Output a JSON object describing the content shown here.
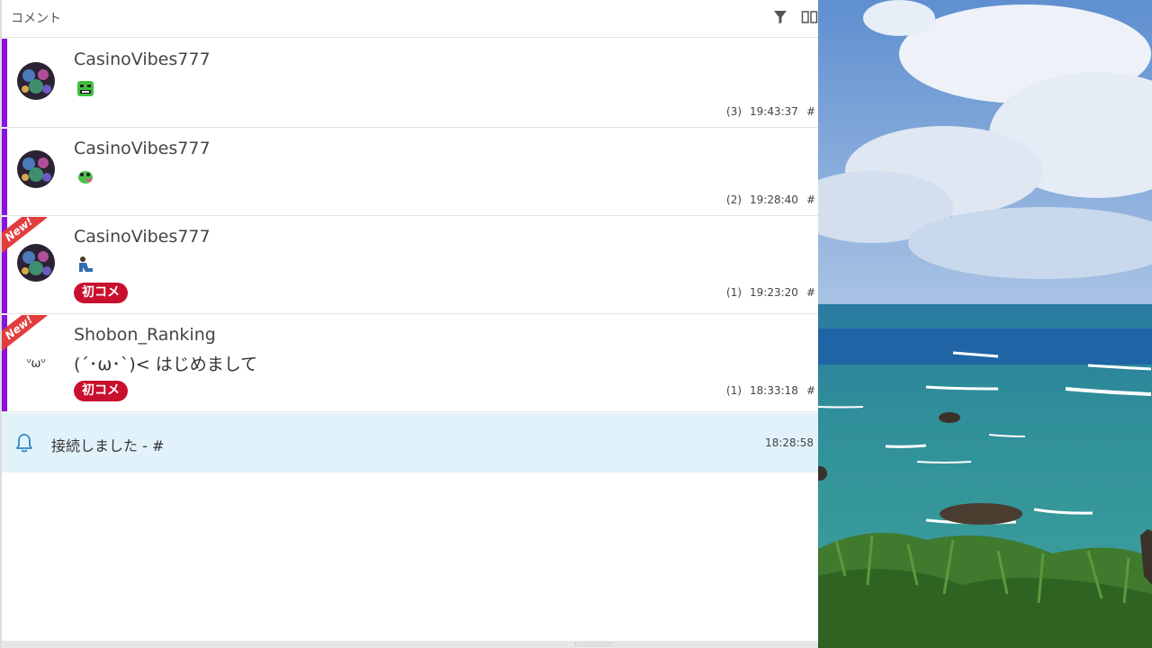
{
  "panel": {
    "title": "コメント",
    "filter_icon": "filter-icon",
    "columns_icon": "columns-icon"
  },
  "comments": [
    {
      "username": "CasinoVibes777",
      "body": "",
      "stamp": "green-face-stamp",
      "count": "(3)",
      "time": "19:43:37",
      "hash": "#",
      "is_new": false,
      "first_comment": false
    },
    {
      "username": "CasinoVibes777",
      "body": "",
      "stamp": "green-frog-stamp",
      "count": "(2)",
      "time": "19:28:40",
      "hash": "#",
      "is_new": false,
      "first_comment": false
    },
    {
      "username": "CasinoVibes777",
      "body": "",
      "stamp": "person-sitting-stamp",
      "count": "(1)",
      "time": "19:23:20",
      "hash": "#",
      "is_new": true,
      "new_label": "New!",
      "first_comment": true,
      "first_label": "初コメ"
    },
    {
      "username": "Shobon_Ranking",
      "body": "(´･ω･`)< はじめまして",
      "avatar_text": "ᐡωᐡ",
      "count": "(1)",
      "time": "18:33:18",
      "hash": "#",
      "is_new": true,
      "new_label": "New!",
      "first_comment": true,
      "first_label": "初コメ"
    }
  ],
  "notice": {
    "icon": "bell-icon",
    "text": "接続しました - #",
    "time": "18:28:58"
  },
  "colors": {
    "stripe": "#8a12e0",
    "new_ribbon": "#e23d3d",
    "first_badge": "#c8102e",
    "notice_bg": "#e2f2fa",
    "bell": "#2f86c8"
  }
}
